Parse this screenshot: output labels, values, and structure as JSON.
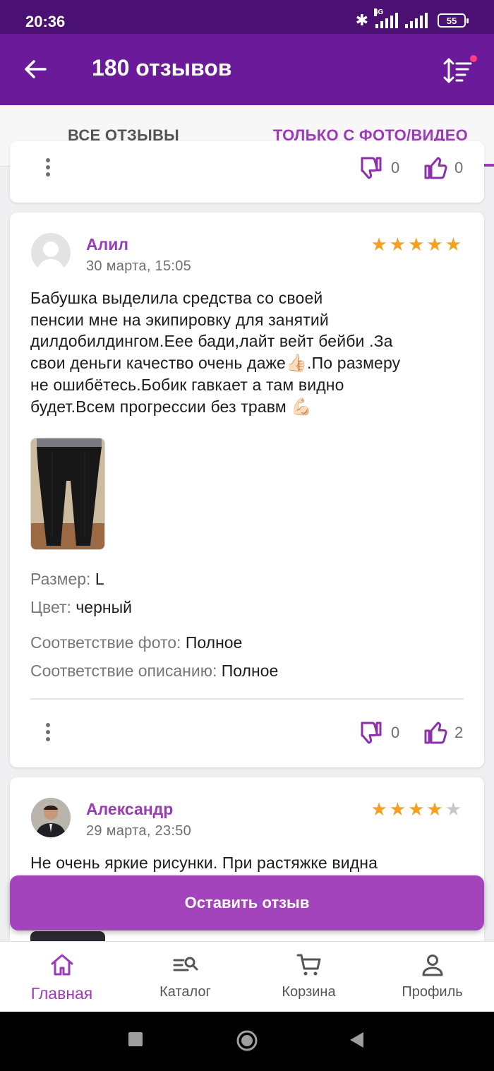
{
  "status_bar": {
    "time": "20:36",
    "network": "4G",
    "battery": "55"
  },
  "app_bar": {
    "title": "180 отзывов",
    "back_icon": "arrow-left-icon",
    "sort_icon": "sort-icon"
  },
  "tabs": [
    {
      "label": "ВСЕ ОТЗЫВЫ",
      "active": false
    },
    {
      "label": "ТОЛЬКО С ФОТО/ВИДЕО",
      "active": true
    }
  ],
  "previous_review": {
    "dislikes": "0",
    "likes": "0"
  },
  "review": {
    "author": "Алил",
    "date": "30 марта, 15:05",
    "rating": 5,
    "text_lines": [
      "Бабушка выделила средства со своей",
      "пенсии мне на экипировку для занятий",
      "дилдобилдингом.Еее бади,лайт вейт бейби .За",
      "свои деньги качество очень даже",
      ".По размеру",
      "не ошибётесь.Бобик гавкает а там видно",
      "будет.Всем прогрессии без травм"
    ],
    "emoji_thumb": "👍🏻",
    "emoji_muscle": "💪🏻",
    "photo_alt": "review-photo",
    "size_label": "Размер:",
    "size_value": "L",
    "color_label": "Цвет:",
    "color_value": "черный",
    "photo_match_label": "Соответствие фото:",
    "photo_match_value": "Полное",
    "desc_match_label": "Соответствие описанию:",
    "desc_match_value": "Полное",
    "dislikes": "0",
    "likes": "2"
  },
  "next_review": {
    "author": "Александр",
    "date": "29 марта, 23:50",
    "rating": 4,
    "text": "Не очень яркие рисунки. При растяжке видна"
  },
  "cta": {
    "label": "Оставить отзыв"
  },
  "bottom_nav": [
    {
      "label": "Главная",
      "icon": "home-icon",
      "active": true
    },
    {
      "label": "Каталог",
      "icon": "catalog-search-icon",
      "active": false
    },
    {
      "label": "Корзина",
      "icon": "cart-icon",
      "active": false
    },
    {
      "label": "Профиль",
      "icon": "profile-icon",
      "active": false
    }
  ],
  "colors": {
    "brand": "#6b1b9a",
    "status_bar": "#4a1173",
    "accent": "#9b3bb5",
    "cta": "#a344bd",
    "star": "#f3a11f"
  }
}
